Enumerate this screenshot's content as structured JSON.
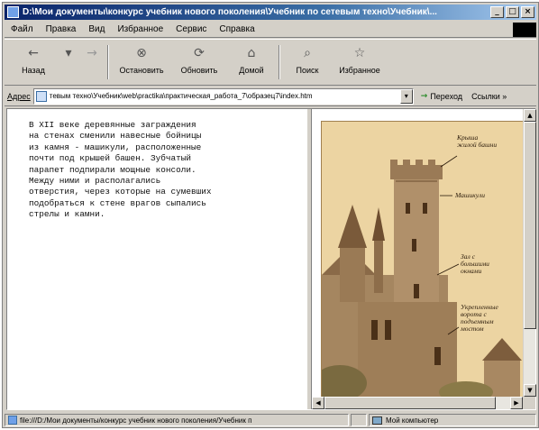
{
  "window": {
    "title": "D:\\Мои документы\\конкурс учебник нового поколения\\Учебник по сетевым техно\\Учебник\\...",
    "controls": {
      "minimize": "_",
      "maximize": "□",
      "close": "×"
    }
  },
  "menu": {
    "items": [
      {
        "label": "Файл"
      },
      {
        "label": "Правка"
      },
      {
        "label": "Вид"
      },
      {
        "label": "Избранное"
      },
      {
        "label": "Сервис"
      },
      {
        "label": "Справка"
      }
    ]
  },
  "toolbar": {
    "back_label": "Назад",
    "back_icon": "←",
    "back_dropdown": "▾",
    "forward_icon": "→",
    "stop_label": "Остановить",
    "stop_icon": "⊗",
    "refresh_label": "Обновить",
    "refresh_icon": "⟳",
    "home_label": "Домой",
    "home_icon": "⌂",
    "search_label": "Поиск",
    "search_icon": "⌕",
    "favorites_label": "Избранное",
    "favorites_icon": "☆"
  },
  "address": {
    "label": "Адрес",
    "url": "тевым техно\\Учебник\\web\\practika\\практическая_работа_7\\образец7\\index.htm",
    "dropdown_icon": "▾",
    "go_label": "Переход",
    "go_icon": "→",
    "links_label": "Ссылки »"
  },
  "content": {
    "text": "В XII веке деревянные заграждения\nна стенах сменили навесные бойницы\nиз камня - машикули, расположенные\nпочти под крышей башен. Зубчатый\nпарапет подпирали мощные консоли.\nМежду ними и располагались\nотверстия, через которые на сумевших\nподобраться к стене врагов сыпались\nстрелы и камни.",
    "callouts": {
      "roof": "Крыша\nжилой башни",
      "machicolations": "Машикули",
      "hall": "Зал с\nбольшими\nокнами",
      "gate": "Укрепленные\nворота с\nподъемным\nмостом"
    }
  },
  "scroll": {
    "up": "▲",
    "down": "▼",
    "left": "◀",
    "right": "▶"
  },
  "status": {
    "url": "file:///D:/Мои документы/конкурс учебник нового поколения/Учебник п",
    "zone": "Мой компьютер"
  },
  "colors": {
    "title_start": "#0a246a",
    "title_end": "#a6caf0",
    "chrome": "#d4d0c8",
    "sepia": "#ecd4a2"
  }
}
